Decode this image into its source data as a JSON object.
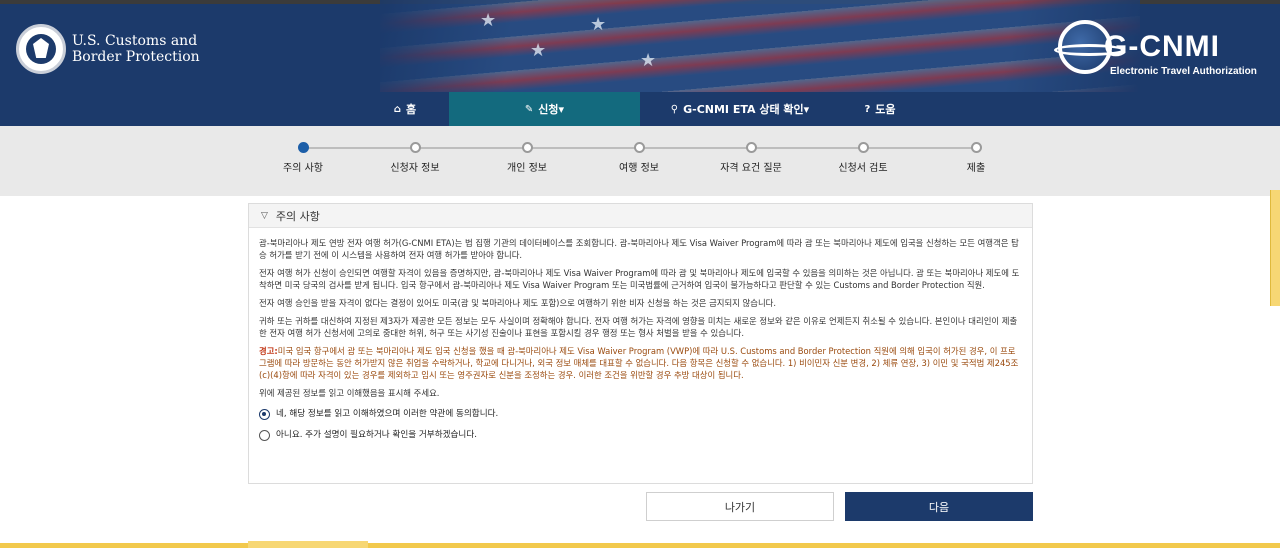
{
  "header": {
    "cbp_line1": "U.S. Customs and",
    "cbp_line2": "Border Protection",
    "brand_title": "G-CNMI",
    "brand_subtitle": "Electronic Travel Authorization",
    "colors": {
      "header_bg": "#1c3a6b",
      "nav_active": "#136a7e"
    }
  },
  "nav": {
    "items": [
      {
        "label": "홈",
        "icon": "home-icon"
      },
      {
        "label": "신청",
        "icon": "pencil-icon",
        "caret": "▾"
      },
      {
        "label": "G-CNMI ETA 상태 확인",
        "icon": "search-icon",
        "caret": "▾"
      },
      {
        "label": "도움",
        "icon": "question-icon"
      }
    ]
  },
  "progress": {
    "steps": [
      "주의 사항",
      "신청자 정보",
      "개인 정보",
      "여행 정보",
      "자격 요건 질문",
      "신청서 검토",
      "제출"
    ],
    "current_index": 0
  },
  "panel": {
    "title": "주의 사항",
    "paragraphs": [
      "괌-북마리아나 제도 연방 전자 여행 허가(G-CNMI ETA)는 법 집행 기관의 데이터베이스를 조회합니다. 괌-북마리아나 제도 Visa Waiver Program에 따라 괌 또는 북마리아나 제도에 입국을 신청하는 모든 여행객은 탑승 허가를 받기 전에 이 시스템을 사용하여 전자 여행 허가를 받아야 합니다.",
      "전자 여행 허가 신청이 승인되면 여행할 자격이 있음을 증명하지만, 괌-북마리아나 제도 Visa Waiver Program에 따라 괌 및 북마리아나 제도에 입국할 수 있음을 의미하는 것은 아닙니다. 괌 또는 북마리아나 제도에 도착하면 미국 당국의 검사를 받게 됩니다. 입국 항구에서 괌-북마리아나 제도 Visa Waiver Program 또는 미국법률에 근거하여 입국이 불가능하다고 판단할 수 있는 Customs and Border Protection 직원.",
      "전자 여행 승인을 받을 자격이 없다는 결정이 있어도 미국(괌 및 북마리아나 제도 포함)으로 여행하기 위한 비자 신청을 하는 것은 금지되지 않습니다.",
      "귀하 또는 귀하를 대신하여 지정된 제3자가 제공한 모든 정보는 모두 사실이며 정확해야 합니다. 전자 여행 허가는 자격에 영향을 미치는 새로운 정보와 같은 이유로 언제든지 취소될 수 있습니다. 본인이나 대리인이 제출한 전자 여행 허가 신청서에 고의로 중대한 허위, 허구 또는 사기성 진술이나 표현을 포함시킬 경우 행정 또는 형사 처벌을 받을 수 있습니다."
    ],
    "warning_label": "경고:",
    "warning_text": "미국 입국 항구에서 괌 또는 북마리아나 제도 입국 신청을 했을 때 괌-북마리아나 제도 Visa Waiver Program (VWP)에 따라 U.S. Customs and Border Protection 직원에 의해 입국이 허가된 경우, 이 프로그램에 따라 방문하는 동안 허가받지 않은 취업을 수락하거나, 학교에 다니거나, 외국 정보 매체를 대표할 수 없습니다. 다음 항목은 신청할 수 없습니다. 1) 비이민자 신분 변경, 2) 체류 연장, 3) 이민 및 국적법 제245조(c)(4)항에 따라 자격이 있는 경우를 제외하고 임시 또는 영주권자로 신분을 조정하는 경우. 이러한 조건을 위반할 경우 추방 대상이 됩니다.",
    "confirm_prompt": "위에 제공된 정보를 읽고 이해했음을 표시해 주세요.",
    "options": [
      {
        "label": "네, 해당 정보를 읽고 이해하였으며 이러한 약관에 동의합니다.",
        "checked": true
      },
      {
        "label": "아니요. 주가 설명이 필요하거나 확인을 거부하겠습니다.",
        "checked": false
      }
    ]
  },
  "buttons": {
    "exit": "나가기",
    "next": "다음"
  }
}
